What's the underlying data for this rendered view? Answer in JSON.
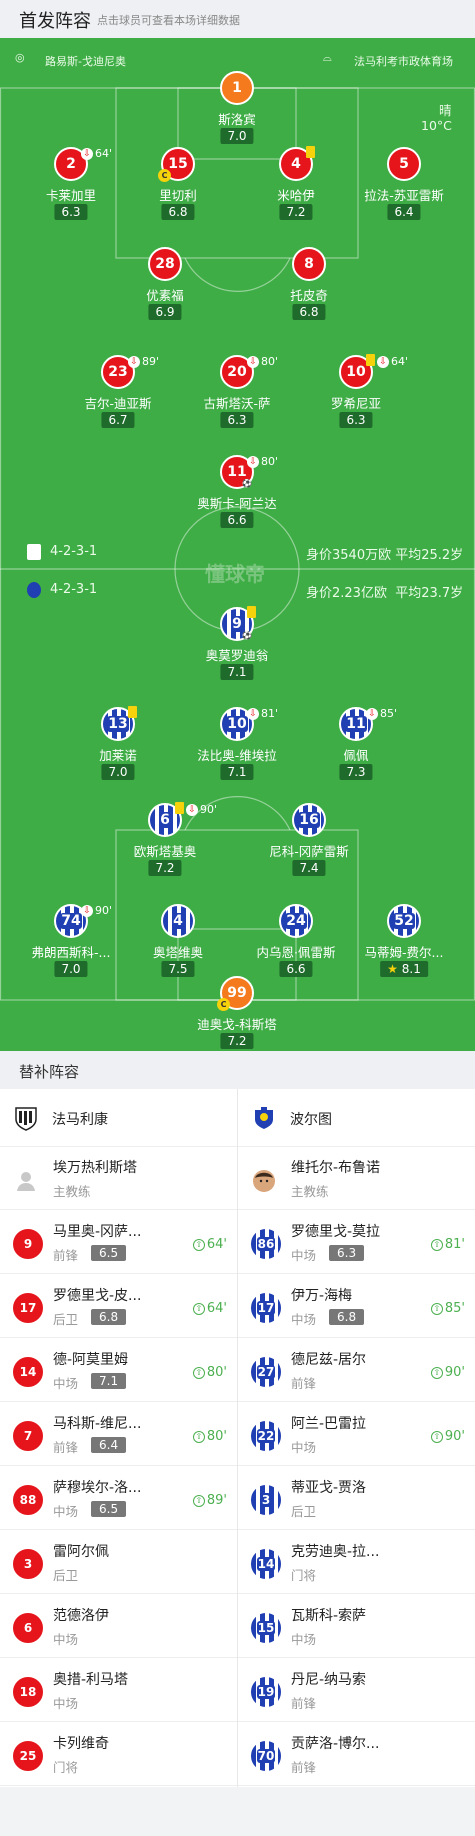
{
  "header": {
    "title": "首发阵容",
    "subtitle": "点击球员可查看本场详细数据"
  },
  "field": {
    "referee": "路易斯-戈迪尼奥",
    "stadium": "法马利考市政体育场",
    "weather": "晴",
    "temperature": "10°C",
    "watermark": "懂球帝",
    "home_formation": "4-2-3-1",
    "home_value": "身价3540万欧 平均25.2岁",
    "away_formation": "4-2-3-1",
    "away_value": "身价2.23亿欧  平均23.7岁"
  },
  "home_players": [
    {
      "num": "1",
      "name": "斯洛宾",
      "rating": "7.0",
      "kit": "gk"
    },
    {
      "num": "2",
      "name": "卡莱加里",
      "rating": "6.3",
      "kit": "red",
      "sub": "64'"
    },
    {
      "num": "15",
      "name": "里切利",
      "rating": "6.8",
      "kit": "red",
      "captain": "C"
    },
    {
      "num": "4",
      "name": "米哈伊",
      "rating": "7.2",
      "kit": "red",
      "yellow": true
    },
    {
      "num": "5",
      "name": "拉法-苏亚雷斯",
      "rating": "6.4",
      "kit": "red"
    },
    {
      "num": "28",
      "name": "优素福",
      "rating": "6.9",
      "kit": "red"
    },
    {
      "num": "8",
      "name": "托皮奇",
      "rating": "6.8",
      "kit": "red"
    },
    {
      "num": "23",
      "name": "吉尔-迪亚斯",
      "rating": "6.7",
      "kit": "red",
      "sub": "89'"
    },
    {
      "num": "20",
      "name": "古斯塔沃-萨",
      "rating": "6.3",
      "kit": "red",
      "sub": "80'"
    },
    {
      "num": "10",
      "name": "罗希尼亚",
      "rating": "6.3",
      "kit": "red",
      "yellow": true,
      "sub": "64'"
    },
    {
      "num": "11",
      "name": "奥斯卡-阿兰达",
      "rating": "6.6",
      "kit": "red",
      "sub": "80'",
      "goal": true
    }
  ],
  "away_players": [
    {
      "num": "9",
      "name": "奥莫罗迪翁",
      "rating": "7.1",
      "kit": "blue",
      "yellow": true,
      "goal": true
    },
    {
      "num": "13",
      "name": "加莱诺",
      "rating": "7.0",
      "kit": "blue",
      "yellow": true
    },
    {
      "num": "10",
      "name": "法比奥-维埃拉",
      "rating": "7.1",
      "kit": "blue",
      "sub": "81'"
    },
    {
      "num": "11",
      "name": "佩佩",
      "rating": "7.3",
      "kit": "blue",
      "sub": "85'"
    },
    {
      "num": "6",
      "name": "欧斯塔基奥",
      "rating": "7.2",
      "kit": "blue",
      "yellow": true,
      "sub": "90'"
    },
    {
      "num": "16",
      "name": "尼科-冈萨雷斯",
      "rating": "7.4",
      "kit": "blue"
    },
    {
      "num": "74",
      "name": "弗朗西斯科-...",
      "rating": "7.0",
      "kit": "blue",
      "sub": "90'"
    },
    {
      "num": "4",
      "name": "奥塔维奥",
      "rating": "7.5",
      "kit": "blue"
    },
    {
      "num": "24",
      "name": "内乌恩·佩雷斯",
      "rating": "6.6",
      "kit": "blue"
    },
    {
      "num": "52",
      "name": "马蒂姆-费尔...",
      "rating": "8.1",
      "kit": "blue",
      "star": true
    },
    {
      "num": "99",
      "name": "迪奥戈-科斯塔",
      "rating": "7.2",
      "kit": "gk",
      "captain": "C"
    }
  ],
  "subs": {
    "title": "替补阵容",
    "home_team": "法马利康",
    "away_team": "波尔图",
    "home_coach": {
      "name": "埃万热利斯塔",
      "role": "主教练"
    },
    "away_coach": {
      "name": "维托尔-布鲁诺",
      "role": "主教练"
    },
    "home": [
      {
        "num": "9",
        "name": "马里奥-冈萨...",
        "pos": "前锋",
        "rating": "6.5",
        "sub": "64'"
      },
      {
        "num": "17",
        "name": "罗德里戈-皮...",
        "pos": "后卫",
        "rating": "6.8",
        "sub": "64'"
      },
      {
        "num": "14",
        "name": "德-阿莫里姆",
        "pos": "中场",
        "rating": "7.1",
        "sub": "80'"
      },
      {
        "num": "7",
        "name": "马科斯-维尼...",
        "pos": "前锋",
        "rating": "6.4",
        "sub": "80'"
      },
      {
        "num": "88",
        "name": "萨穆埃尔-洛...",
        "pos": "中场",
        "rating": "6.5",
        "sub": "89'"
      },
      {
        "num": "3",
        "name": "雷阿尔佩",
        "pos": "后卫"
      },
      {
        "num": "6",
        "name": "范德洛伊",
        "pos": "中场"
      },
      {
        "num": "18",
        "name": "奥措-利马塔",
        "pos": "中场"
      },
      {
        "num": "25",
        "name": "卡列维奇",
        "pos": "门将"
      }
    ],
    "away": [
      {
        "num": "86",
        "name": "罗德里戈-莫拉",
        "pos": "中场",
        "rating": "6.3",
        "sub": "81'"
      },
      {
        "num": "17",
        "name": "伊万-海梅",
        "pos": "中场",
        "rating": "6.8",
        "sub": "85'"
      },
      {
        "num": "27",
        "name": "德尼兹-居尔",
        "pos": "前锋",
        "sub": "90'"
      },
      {
        "num": "22",
        "name": "阿兰-巴雷拉",
        "pos": "中场",
        "sub": "90'"
      },
      {
        "num": "3",
        "name": "蒂亚戈-贾洛",
        "pos": "后卫"
      },
      {
        "num": "14",
        "name": "克劳迪奥-拉...",
        "pos": "门将"
      },
      {
        "num": "15",
        "name": "瓦斯科-索萨",
        "pos": "中场"
      },
      {
        "num": "19",
        "name": "丹尼-纳马索",
        "pos": "前锋"
      },
      {
        "num": "70",
        "name": "贡萨洛-博尔...",
        "pos": "前锋"
      }
    ]
  },
  "colors": {
    "field": "#3fad46",
    "home_kit": "#e5151b",
    "away_kit": "#1f3fb2",
    "gk_kit": "#f47a1d"
  }
}
